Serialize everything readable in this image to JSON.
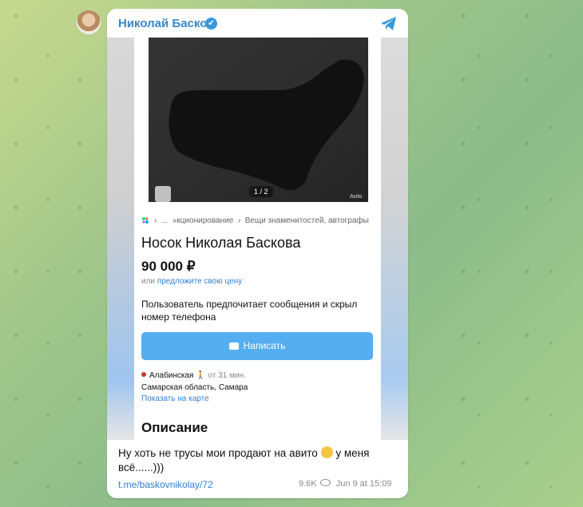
{
  "channel": {
    "name": "Николай Басков",
    "verified_mark": "✔"
  },
  "listing": {
    "photo_counter": "1 / 2",
    "photo_watermark": "Avito",
    "breadcrumb": "...  ›  лекционирование  ›  Вещи знаменитостей, автографы",
    "breadcrumb_parts": [
      "...",
      "»кционирование",
      "Вещи знаменитостей, автографы"
    ],
    "title": "Носок Николая Баскова",
    "price": "90 000 ₽",
    "price_or": "или",
    "price_offer_link": "предложите свою цену",
    "seller_note": "Пользователь предпочитает сообщения и скрыл номер телефона",
    "write_button": "Написать",
    "metro_station": "Алабинская",
    "metro_time": "от 31 мин.",
    "region": "Самарская область, Самара",
    "map_link": "Показать на карте",
    "description_heading": "Описание"
  },
  "post": {
    "caption_before_emoji": "Ну хоть не трусы мои продают на авито",
    "caption_after_emoji": "у меня всё......)))",
    "link": "t.me/baskovnikolay/72",
    "views": "9.6K",
    "date": "Jun 9 at 15:09"
  },
  "icons": {
    "header": "telegram-icon",
    "verified": "verified-icon",
    "views": "eye-icon",
    "button": "message-icon",
    "emoji": "smirking-emoji-icon"
  },
  "colors": {
    "accent": "#3a86c8",
    "button": "#55aef0",
    "link": "#2f80d1",
    "metro": "#d0342c"
  }
}
